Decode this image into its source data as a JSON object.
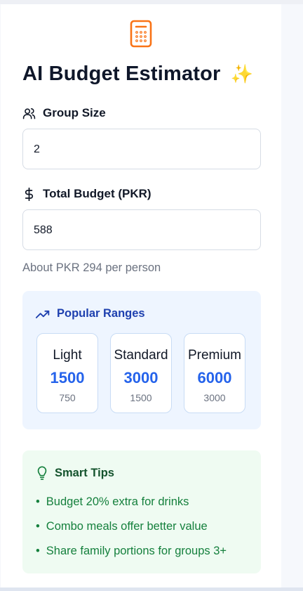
{
  "header": {
    "title": "AI Budget Estimator",
    "sparkle": "✨",
    "icon": "calculator-icon",
    "accent_color": "#f97316"
  },
  "group_size": {
    "label": "Group Size",
    "icon": "users-icon",
    "value": "2"
  },
  "total_budget": {
    "label": "Total Budget (PKR)",
    "icon": "dollar-icon",
    "value": "588",
    "helper": "About PKR 294 per person"
  },
  "popular_ranges": {
    "title": "Popular Ranges",
    "icon": "trending-up-icon",
    "items": [
      {
        "name": "Light",
        "amount": "1500",
        "per_person": "750"
      },
      {
        "name": "Standard",
        "amount": "3000",
        "per_person": "1500"
      },
      {
        "name": "Premium",
        "amount": "6000",
        "per_person": "3000"
      }
    ]
  },
  "smart_tips": {
    "title": "Smart Tips",
    "icon": "lightbulb-icon",
    "bullet": "•",
    "items": [
      "Budget 20% extra for drinks",
      "Combo meals offer better value",
      "Share family portions for groups 3+"
    ]
  }
}
